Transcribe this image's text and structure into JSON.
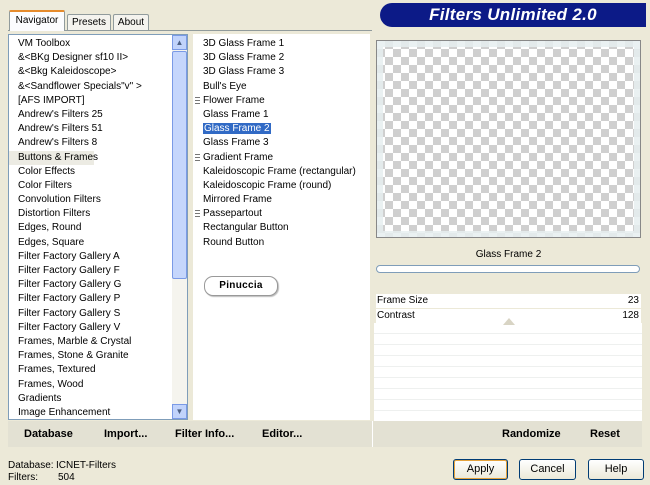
{
  "tabs": [
    {
      "label": "Navigator",
      "active": true
    },
    {
      "label": "Presets",
      "active": false
    },
    {
      "label": "About",
      "active": false
    }
  ],
  "banner": {
    "title": "Filters Unlimited 2.0",
    "bg": "#0c1a87"
  },
  "categories": [
    "VM Toolbox",
    "&<BKg Designer sf10 II>",
    "&<Bkg Kaleidoscope>",
    "&<Sandflower Specials\"v\" >",
    "[AFS IMPORT]",
    "Andrew's Filters 25",
    "Andrew's Filters 51",
    "Andrew's Filters 8",
    "Buttons & Frames",
    "Color Effects",
    "Color Filters",
    "Convolution Filters",
    "Distortion Filters",
    "Edges, Round",
    "Edges, Square",
    "Filter Factory Gallery A",
    "Filter Factory Gallery F",
    "Filter Factory Gallery G",
    "Filter Factory Gallery P",
    "Filter Factory Gallery S",
    "Filter Factory Gallery V",
    "Frames, Marble & Crystal",
    "Frames, Stone & Granite",
    "Frames, Textured",
    "Frames, Wood",
    "Gradients",
    "Image Enhancement"
  ],
  "selected_category": "Buttons & Frames",
  "filters": [
    {
      "label": "3D Glass Frame 1",
      "group": false
    },
    {
      "label": "3D Glass Frame 2",
      "group": false
    },
    {
      "label": "3D Glass Frame 3",
      "group": false
    },
    {
      "label": "Bull's Eye",
      "group": false
    },
    {
      "label": "Flower Frame",
      "group": true
    },
    {
      "label": "Glass Frame 1",
      "group": false
    },
    {
      "label": "Glass Frame 2",
      "group": false
    },
    {
      "label": "Glass Frame 3",
      "group": false
    },
    {
      "label": "Gradient Frame",
      "group": true
    },
    {
      "label": "Kaleidoscopic Frame (rectangular)",
      "group": false
    },
    {
      "label": "Kaleidoscopic Frame (round)",
      "group": false
    },
    {
      "label": "Mirrored Frame",
      "group": false
    },
    {
      "label": "Passepartout",
      "group": true
    },
    {
      "label": "Rectangular Button",
      "group": false
    },
    {
      "label": "Round Button",
      "group": false
    }
  ],
  "selected_filter": "Glass Frame 2",
  "watermark": "Pinuccia",
  "preview": {
    "filter_name": "Glass Frame 2"
  },
  "params": [
    {
      "label": "Frame Size",
      "value": "23"
    },
    {
      "label": "Contrast",
      "value": "128"
    }
  ],
  "toolbar": {
    "database_label": "Database",
    "import_label": "Import...",
    "filter_info_label": "Filter Info...",
    "editor_label": "Editor...",
    "randomize_label": "Randomize",
    "reset_label": "Reset"
  },
  "status": {
    "database_key": "Database:",
    "database_value": "ICNET-Filters",
    "filters_key": "Filters:",
    "filters_value": "504"
  },
  "buttons": {
    "apply": "Apply",
    "cancel": "Cancel",
    "help": "Help"
  },
  "colors": {
    "selection": "#316ac5",
    "accent_tab": "#e68b2c",
    "window_bg": "#ece9d8"
  }
}
